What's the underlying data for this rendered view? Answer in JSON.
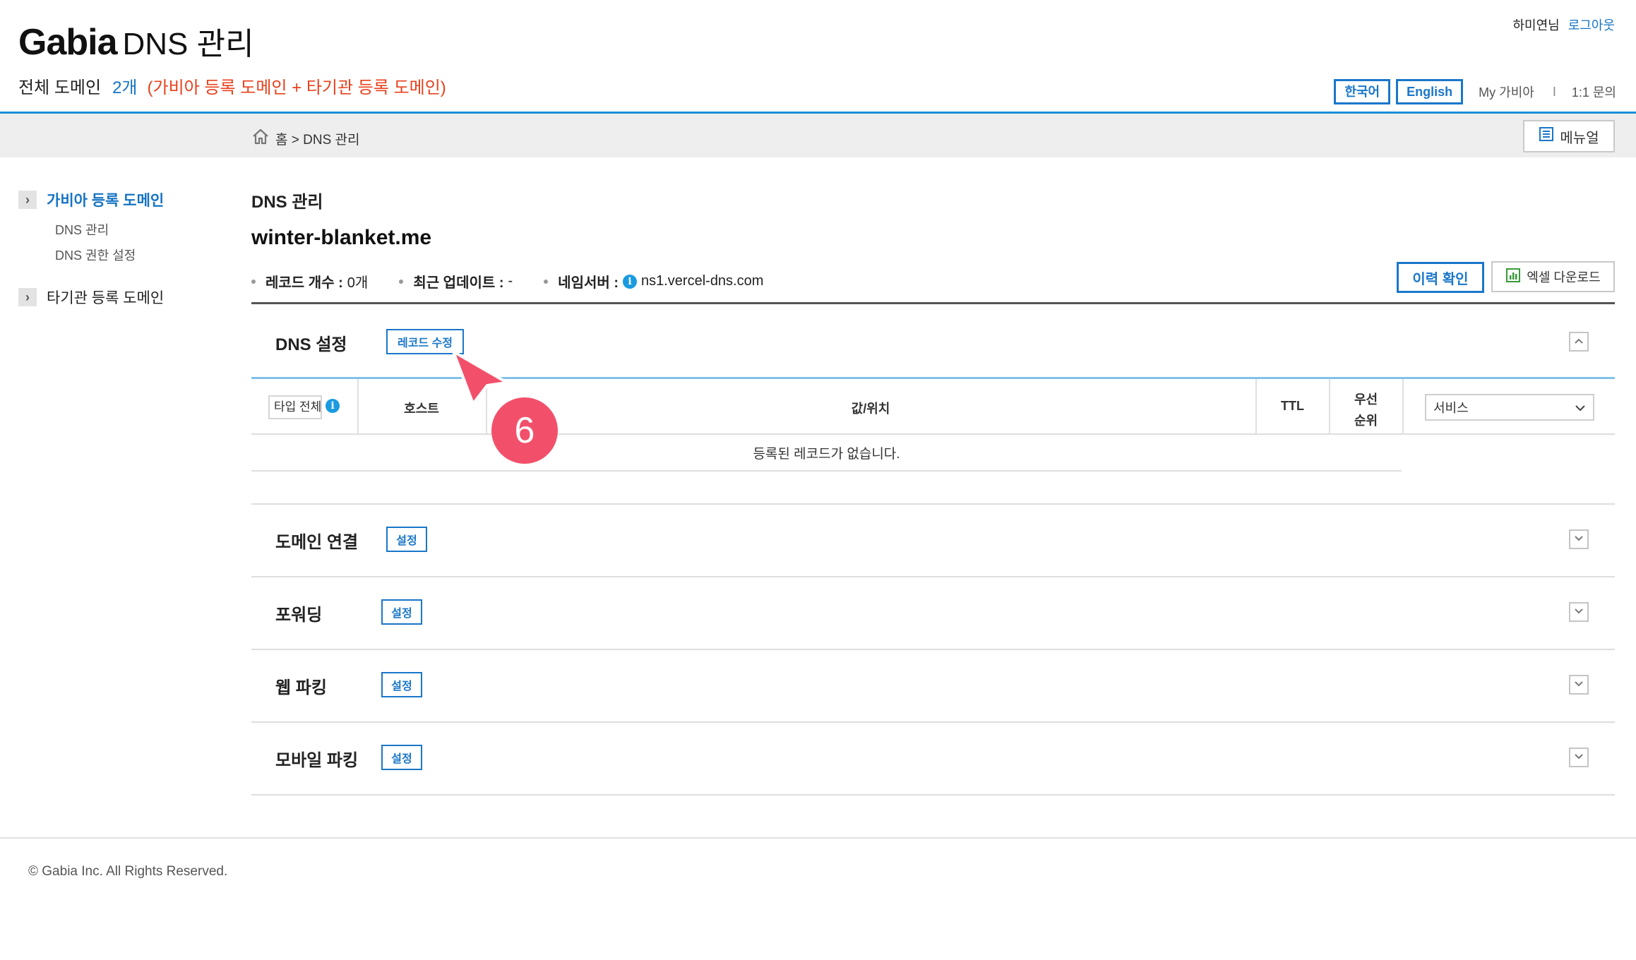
{
  "header": {
    "brand": "Gabia",
    "product": "DNS 관리",
    "summary_label": "전체 도메인",
    "summary_count": "2개",
    "summary_note": "(가비아 등록 도메인 + 타기관 등록 도메인)",
    "user_name": "하미연님",
    "logout": "로그아웃",
    "lang_ko": "한국어",
    "lang_en": "English",
    "my_gabia": "My 가비아",
    "separator": "I",
    "inquiry": "1:1 문의"
  },
  "breadcrumb": {
    "text": "홈 > DNS 관리",
    "manual_button": "메뉴얼"
  },
  "sidebar": {
    "items": [
      {
        "label": "가비아 등록 도메인",
        "arrow": "›"
      },
      {
        "label": "타기관 등록 도메인",
        "arrow": "›"
      }
    ],
    "subitems": [
      {
        "label": "DNS 관리"
      },
      {
        "label": "DNS 권한 설정"
      }
    ]
  },
  "main": {
    "section_title": "DNS 관리",
    "domain": "winter-blanket.me",
    "meta": {
      "record_label": "레코드 개수 :",
      "record_value": "0개",
      "update_label": "최근 업데이트 :",
      "update_value": "-",
      "ns_label": "네임서버 :",
      "ns_value": "ns1.vercel-dns.com"
    },
    "history_button": "이력 확인",
    "excel_button": "엑셀 다운로드",
    "dns_settings": {
      "title": "DNS 설정",
      "edit_button": "레코드 수정",
      "type_filter": "타입 전체",
      "columns": {
        "host": "호스트",
        "value": "값/위치",
        "ttl": "TTL",
        "priority_1": "우선",
        "priority_2": "순위"
      },
      "service_select": "서비스",
      "empty_message": "등록된 레코드가 없습니다."
    },
    "panels": [
      {
        "title": "도메인 연결",
        "button": "설정"
      },
      {
        "title": "포워딩",
        "button": "설정"
      },
      {
        "title": "웹 파킹",
        "button": "설정"
      },
      {
        "title": "모바일 파킹",
        "button": "설정"
      }
    ]
  },
  "callout": {
    "number": "6",
    "color": "#f2506a"
  },
  "footer": {
    "copyright": "© Gabia Inc. All Rights Reserved."
  },
  "colors": {
    "accent": "#1a77c9",
    "note": "#e8401c"
  }
}
